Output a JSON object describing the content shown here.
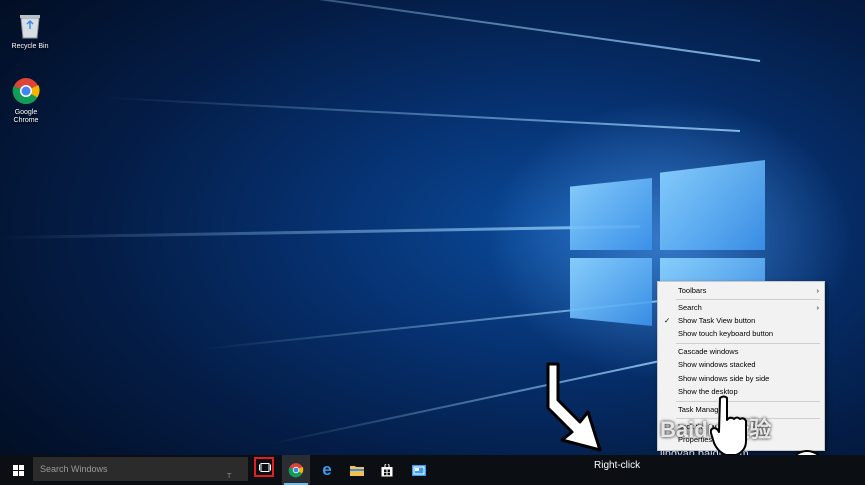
{
  "desktop": {
    "icons": [
      {
        "label": "Recycle Bin",
        "icon": "recycle-bin-icon"
      },
      {
        "label": "Google Chrome",
        "label_line1": "Google",
        "label_line2": "Chrome",
        "icon": "chrome-icon"
      }
    ]
  },
  "taskbar": {
    "start_icon": "windows-logo-icon",
    "search_placeholder": "Search Windows",
    "pinned": [
      {
        "name": "task-view",
        "icon": "task-view-icon",
        "highlighted": true
      },
      {
        "name": "chrome",
        "icon": "chrome-icon"
      },
      {
        "name": "edge",
        "icon": "edge-icon"
      },
      {
        "name": "file-explorer",
        "icon": "folder-icon"
      },
      {
        "name": "store",
        "icon": "store-icon"
      },
      {
        "name": "outlook",
        "icon": "mail-icon"
      }
    ]
  },
  "annotation": {
    "right_click_label": "Right-click",
    "highlight_color": "#e02020"
  },
  "context_menu": {
    "items": [
      {
        "label": "Toolbars",
        "submenu": true
      },
      {
        "label": "Search",
        "submenu": true
      },
      {
        "label": "Show Task View button",
        "checked": true
      },
      {
        "label": "Show touch keyboard button"
      },
      {
        "label": "Cascade windows"
      },
      {
        "label": "Show windows stacked"
      },
      {
        "label": "Show windows side by side"
      },
      {
        "label": "Show the desktop"
      },
      {
        "label": "Task Manager"
      },
      {
        "label": "Lock the taskbar"
      },
      {
        "label": "Properties"
      }
    ]
  },
  "watermark": {
    "brand": "Baidu 经验",
    "url": "jingyan.baidu.com"
  },
  "colors": {
    "wallpaper_blue": "#0a4a9a",
    "taskbar": "#0b0f14",
    "menu_bg": "#f2f2f2"
  }
}
